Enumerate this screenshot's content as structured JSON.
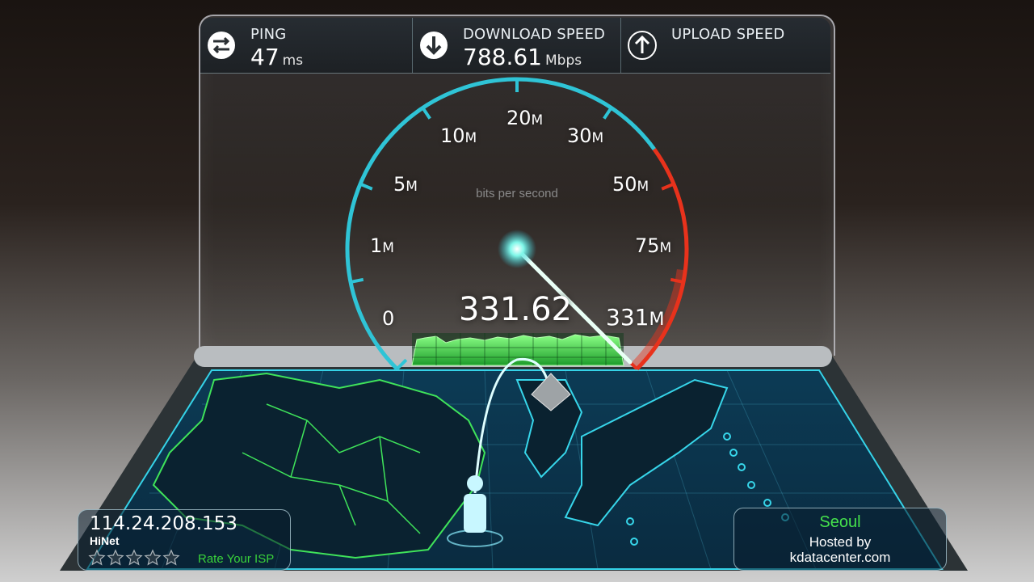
{
  "stats": {
    "ping": {
      "title": "PING",
      "value": "47",
      "unit": "ms",
      "icon": "ping-arrows-icon"
    },
    "download": {
      "title": "DOWNLOAD SPEED",
      "value": "788.61",
      "unit": "Mbps",
      "icon": "download-arrow-icon"
    },
    "upload": {
      "title": "UPLOAD SPEED",
      "icon": "upload-arrow-icon"
    }
  },
  "gauge": {
    "caption": "bits per second",
    "reading": "331.62",
    "labels": [
      {
        "num": "0",
        "suffix": ""
      },
      {
        "num": "1",
        "suffix": "M"
      },
      {
        "num": "5",
        "suffix": "M"
      },
      {
        "num": "10",
        "suffix": "M"
      },
      {
        "num": "20",
        "suffix": "M"
      },
      {
        "num": "30",
        "suffix": "M"
      },
      {
        "num": "50",
        "suffix": "M"
      },
      {
        "num": "75",
        "suffix": "M"
      },
      {
        "num": "331",
        "suffix": "M"
      }
    ],
    "accent_color": "#2fc4d6",
    "redline_color": "#e8321c",
    "needle_color": "#e9fff6"
  },
  "client": {
    "ip": "114.24.208.153",
    "isp": "HiNet",
    "rating_max": 5,
    "rate_label": "Rate Your ISP",
    "rate_color": "#39d23a"
  },
  "server": {
    "city": "Seoul",
    "hosted_by": "Hosted by",
    "host": "kdatacenter.com",
    "city_color": "#45e24c"
  }
}
